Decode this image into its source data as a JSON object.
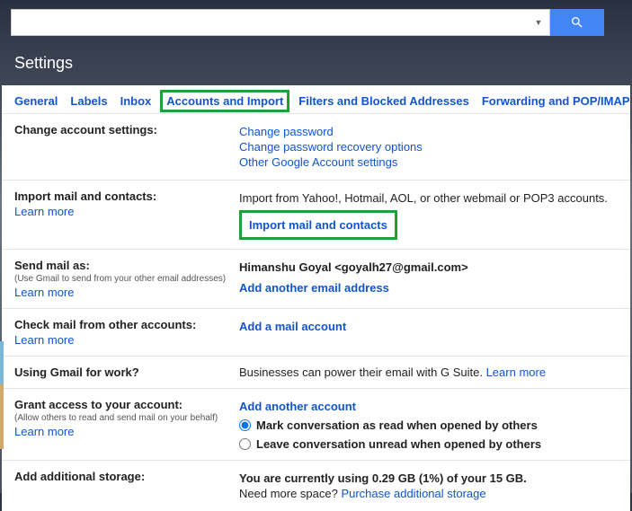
{
  "page_title": "Settings",
  "tabs": {
    "general": "General",
    "labels": "Labels",
    "inbox": "Inbox",
    "accounts": "Accounts and Import",
    "filters": "Filters and Blocked Addresses",
    "forwarding": "Forwarding and POP/IMAP"
  },
  "change_account": {
    "label": "Change account settings:",
    "change_password": "Change password",
    "change_recovery": "Change password recovery options",
    "other_settings": "Other Google Account settings"
  },
  "import_mail": {
    "label": "Import mail and contacts:",
    "learn_more": "Learn more",
    "desc": "Import from Yahoo!, Hotmail, AOL, or other webmail or POP3 accounts.",
    "action": "Import mail and contacts"
  },
  "send_mail": {
    "label": "Send mail as:",
    "sub": "(Use Gmail to send from your other email addresses)",
    "learn_more": "Learn more",
    "identity": "Himanshu Goyal <goyalh27@gmail.com>",
    "add": "Add another email address"
  },
  "check_mail": {
    "label": "Check mail from other accounts:",
    "learn_more": "Learn more",
    "add": "Add a mail account"
  },
  "gsuite": {
    "label": "Using Gmail for work?",
    "desc": "Businesses can power their email with G Suite. ",
    "learn_more": "Learn more"
  },
  "grant_access": {
    "label": "Grant access to your account:",
    "sub": "(Allow others to read and send mail on your behalf)",
    "learn_more": "Learn more",
    "add": "Add another account",
    "radio_read": "Mark conversation as read when opened by others",
    "radio_unread": "Leave conversation unread when opened by others"
  },
  "storage": {
    "label": "Add additional storage:",
    "usage": "You are currently using 0.29 GB (1%) of your 15 GB.",
    "need_more": "Need more space? ",
    "purchase": "Purchase additional storage"
  }
}
